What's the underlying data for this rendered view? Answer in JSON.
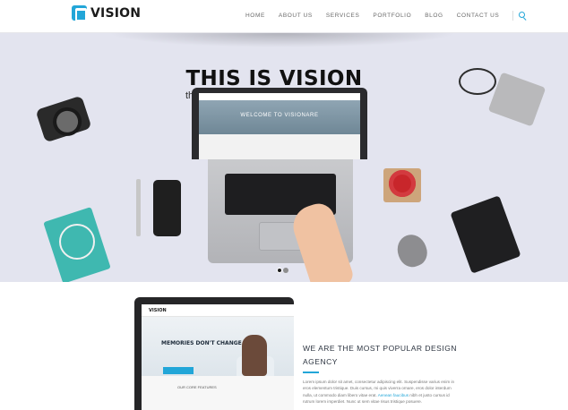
{
  "header": {
    "logo_text": "VISION",
    "nav": [
      "HOME",
      "ABOUT US",
      "SERVICES",
      "PORTFOLIO",
      "BLOG",
      "CONTACT US"
    ]
  },
  "hero": {
    "title": "THIS IS VISION",
    "subtitle": "the latest multipurpose wordpress theme",
    "screen_text": "WELCOME TO VISIONARE",
    "slides": 2,
    "active_slide": 1
  },
  "section2": {
    "preview": {
      "logo": "VISION",
      "headline": "MEMORIES DON'T CHANGE",
      "features": "OUR CORE FEATURES"
    },
    "title": "WE ARE THE MOST POPULAR DESIGN AGENCY",
    "body_1": "Lorem ipsum dolor sit amet, consectetur adipiscing elit. Suspendisse varius enim in eros elementum tristique. Duis cursus, mi quis viverra ornare, eros dolor interdum nulla, ut commodo diam libero vitae erat.",
    "body_link": "Aenean faucibus",
    "body_2": "nibh et justo cursus id rutrum lorem imperdiet. Nunc ut sem vitae risus tristique posuere."
  },
  "colors": {
    "accent": "#22a6d8",
    "hero_bg": "#e3e4ef"
  },
  "icons": {
    "logo": "vision-logo-icon",
    "search": "search-icon"
  }
}
